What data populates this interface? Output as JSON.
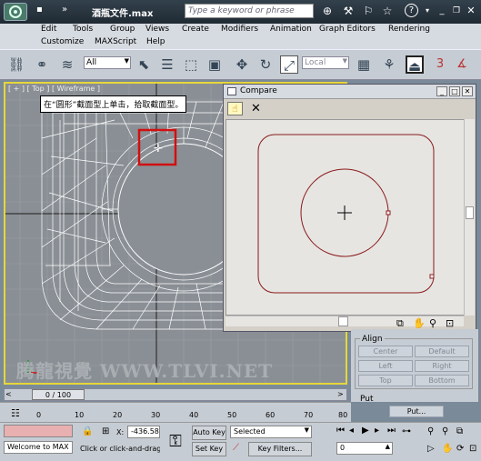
{
  "titlebar": {
    "nav_arrow": "▸",
    "doc_title": "酒瓶文件.max",
    "expand_arrows": "»",
    "search_placeholder": "Type a keyword or phrase",
    "search_icon": "binoculars-icon",
    "star_icon": "star-icon",
    "help_label": "?"
  },
  "menu": {
    "row1": [
      "Edit",
      "Tools",
      "Group",
      "Views",
      "Create",
      "Modifiers",
      "Animation",
      "Graph Editors",
      "Rendering"
    ],
    "row2": [
      "Customize",
      "MAXScript",
      "Help"
    ]
  },
  "toolbar": {
    "selection_filter": "All",
    "reference_coord": "Local",
    "snaps_label": "3"
  },
  "viewport": {
    "label": "[ + ] [ Top ] [ Wireframe ]",
    "tooltip": "在“圆形”截面型上单击，拾取截面型。",
    "watermark": "腾龍視覺 WWW.TLVI.NET"
  },
  "compare": {
    "title": "Compare"
  },
  "command_panel": {
    "align_title": "Align",
    "center": "Center",
    "default": "Default",
    "left": "Left",
    "right": "Right",
    "top": "Top",
    "bottom": "Bottom",
    "put_title": "Put",
    "put_button": "Put..."
  },
  "timeline": {
    "frame_display": "0 / 100",
    "ticks": [
      "0",
      "10",
      "20",
      "30",
      "40",
      "50",
      "60",
      "70",
      "80"
    ]
  },
  "status": {
    "maxscript_listener": "Welcome to MAX",
    "prompt": "Click or click-and-drag",
    "x_label": "X:",
    "x_value": "-436.58",
    "auto_key": "Auto Key",
    "set_key": "Set Key",
    "selected": "Selected",
    "key_filters": "Key Filters...",
    "frame": "0"
  },
  "colors": {
    "viewport_border": "#e6d63a",
    "wire": "#ffffff",
    "shape_curve": "#8a1a1a",
    "tooltip_highlight": "#d01010"
  }
}
